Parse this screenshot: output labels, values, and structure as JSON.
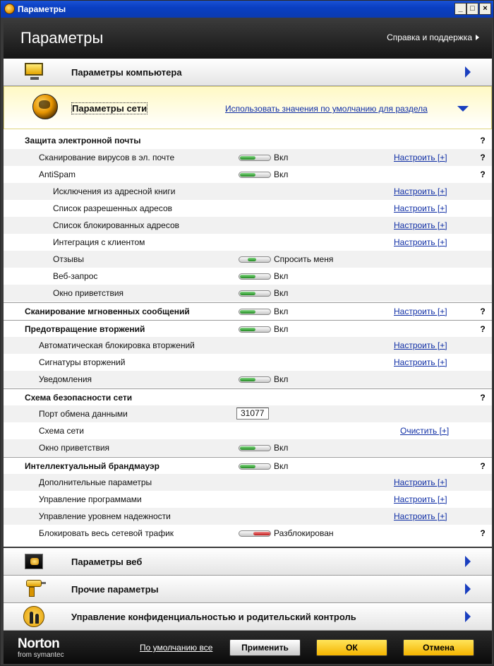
{
  "window": {
    "title": "Параметры"
  },
  "header": {
    "title": "Параметры",
    "help": "Справка и поддержка"
  },
  "categories": {
    "computer": "Параметры компьютера",
    "network": "Параметры сети",
    "network_default": "Использовать значения по умолчанию для раздела",
    "web": "Параметры веб",
    "other": "Прочие параметры",
    "privacy": "Управление конфиденциальностью и родительский контроль"
  },
  "rows": [
    {
      "label": "Защита электронной почты",
      "help": "?"
    },
    {
      "label": "Сканирование вирусов в эл. почте",
      "state": "Вкл",
      "link": "Настроить [+]",
      "help": "?"
    },
    {
      "label": "AntiSpam",
      "state": "Вкл",
      "help": "?"
    },
    {
      "label": "Исключения из адресной книги",
      "link": "Настроить [+]"
    },
    {
      "label": "Список разрешенных адресов",
      "link": "Настроить [+]"
    },
    {
      "label": "Список блокированных адресов",
      "link": "Настроить [+]"
    },
    {
      "label": "Интеграция с клиентом",
      "link": "Настроить [+]"
    },
    {
      "label": "Отзывы",
      "state": "Спросить меня"
    },
    {
      "label": "Веб-запрос",
      "state": "Вкл"
    },
    {
      "label": "Окно приветствия",
      "state": "Вкл"
    },
    {
      "label": "Сканирование мгновенных сообщений",
      "state": "Вкл",
      "link": "Настроить [+]",
      "help": "?"
    },
    {
      "label": "Предотвращение вторжений",
      "state": "Вкл",
      "help": "?"
    },
    {
      "label": "Автоматическая блокировка вторжений",
      "link": "Настроить [+]"
    },
    {
      "label": "Сигнатуры вторжений",
      "link": "Настроить [+]"
    },
    {
      "label": "Уведомления",
      "state": "Вкл"
    },
    {
      "label": "Схема безопасности сети",
      "help": "?"
    },
    {
      "label": "Порт обмена данными",
      "value": "31077"
    },
    {
      "label": "Схема сети",
      "link": "Очистить [+]"
    },
    {
      "label": "Окно приветствия",
      "state": "Вкл"
    },
    {
      "label": "Интеллектуальный брандмауэр",
      "state": "Вкл",
      "help": "?"
    },
    {
      "label": "Дополнительные параметры",
      "link": "Настроить [+]"
    },
    {
      "label": "Управление программами",
      "link": "Настроить [+]"
    },
    {
      "label": "Управление уровнем надежности",
      "link": "Настроить [+]"
    },
    {
      "label": "Блокировать весь сетевой трафик",
      "state": "Разблокирован",
      "help": "?"
    }
  ],
  "footer": {
    "brand": "Norton",
    "brand_sub": "from symantec",
    "defaults": "По умолчанию все",
    "apply": "Применить",
    "ok": "ОК",
    "cancel": "Отмена"
  }
}
